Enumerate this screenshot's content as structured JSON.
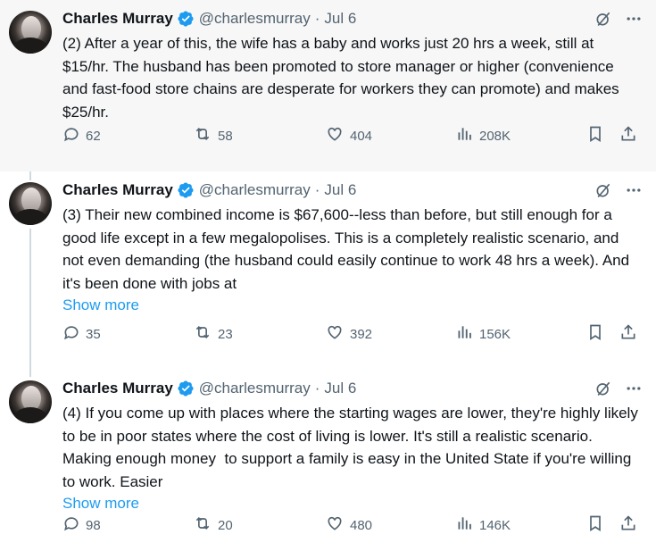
{
  "tweets": [
    {
      "author": "Charles Murray",
      "handle": "@charlesmurray",
      "separator": "·",
      "date": "Jul 6",
      "text": "(2) After a year of this, the wife has a baby and works just 20 hrs a week, still at $15/hr. The husband has been promoted to store manager or higher (convenience and fast-food store chains are desperate for workers they can promote) and makes $25/hr.",
      "show_more": "",
      "replies": "62",
      "reposts": "58",
      "likes": "404",
      "views": "208K"
    },
    {
      "author": "Charles Murray",
      "handle": "@charlesmurray",
      "separator": "·",
      "date": "Jul 6",
      "text": "(3) Their new combined income is $67,600--less than before, but still enough for a good life except in a few megalopolises. This is a completely realistic scenario, and not even demanding (the husband could easily continue to work 48 hrs a week). And it's been done with jobs at",
      "show_more": "Show more",
      "replies": "35",
      "reposts": "23",
      "likes": "392",
      "views": "156K"
    },
    {
      "author": "Charles Murray",
      "handle": "@charlesmurray",
      "separator": "·",
      "date": "Jul 6",
      "text": "(4) If you come up with places where the starting wages are lower, they're highly likely to be in poor states where the cost of living is lower. It's still a realistic scenario. Making enough money  to support a family is easy in the United State if you're willing to work. Easier",
      "show_more": "Show more",
      "replies": "98",
      "reposts": "20",
      "likes": "480",
      "views": "146K"
    }
  ],
  "icons": {
    "verified": "verified-badge-icon",
    "grok": "grok-icon",
    "more": "more-icon",
    "reply": "reply-icon",
    "repost": "repost-icon",
    "like": "like-icon",
    "views": "views-icon",
    "bookmark": "bookmark-icon",
    "share": "share-icon"
  },
  "colors": {
    "text": "#0f1419",
    "secondary": "#536471",
    "accent": "#1d9bf0",
    "highlight_bg": "#f7f7f7",
    "thread_line": "#cfd9de"
  }
}
